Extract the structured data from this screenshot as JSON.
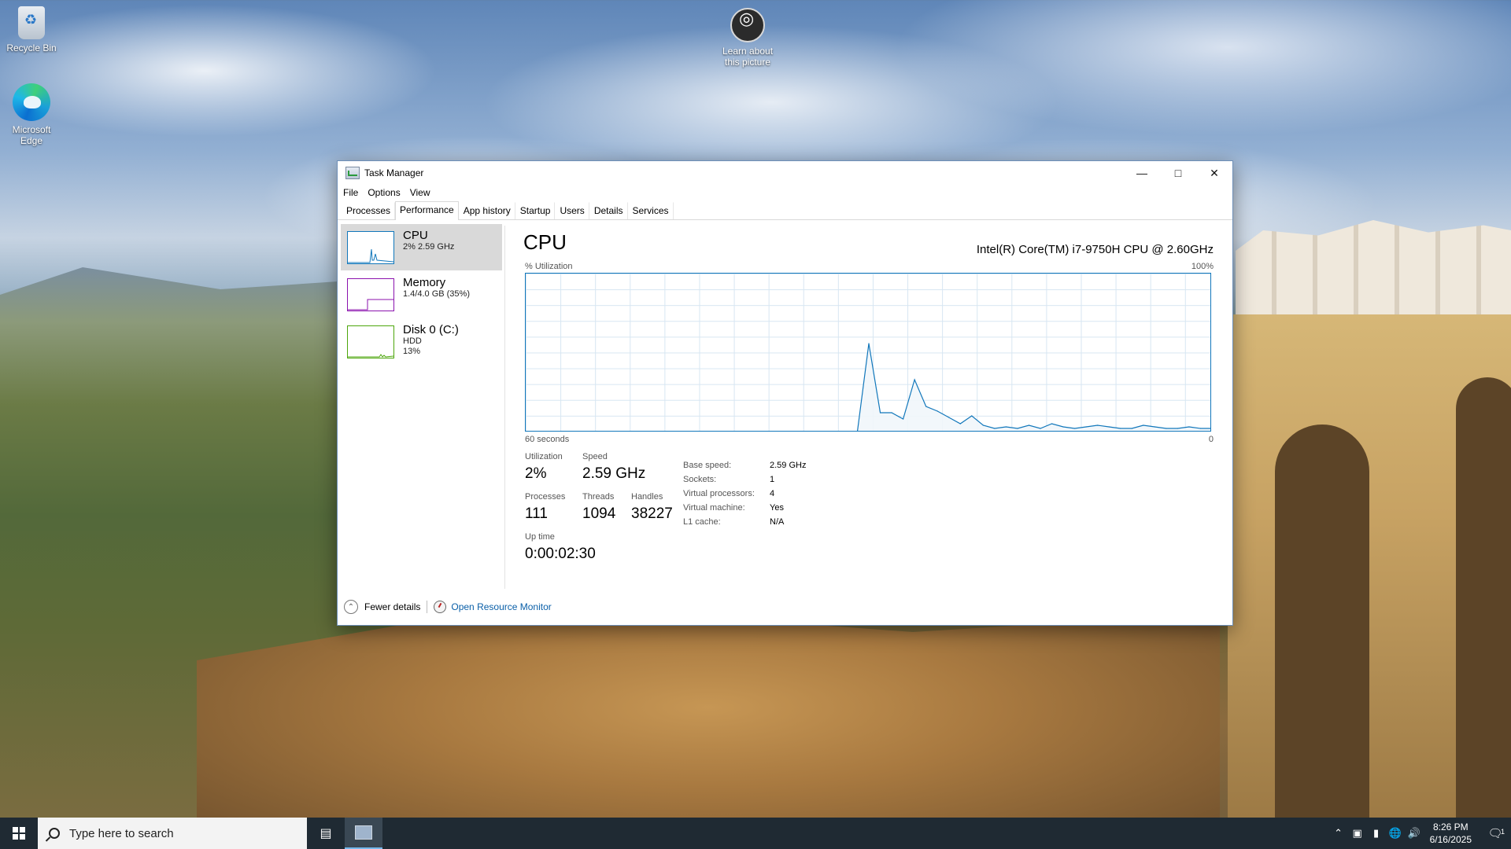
{
  "desktop": {
    "icons": [
      {
        "label": "Recycle Bin"
      },
      {
        "label": "Microsoft Edge"
      },
      {
        "label": "Learn about this picture"
      }
    ]
  },
  "window": {
    "title": "Task Manager",
    "menu": [
      "File",
      "Options",
      "View"
    ],
    "tabs": [
      "Processes",
      "Performance",
      "App history",
      "Startup",
      "Users",
      "Details",
      "Services"
    ],
    "active_tab": "Performance"
  },
  "sidebar": {
    "items": [
      {
        "name": "CPU",
        "line1": "2% 2.59 GHz",
        "line2": ""
      },
      {
        "name": "Memory",
        "line1": "1.4/4.0 GB (35%)",
        "line2": ""
      },
      {
        "name": "Disk 0 (C:)",
        "line1": "HDD",
        "line2": "13%"
      }
    ]
  },
  "cpu": {
    "title": "CPU",
    "model": "Intel(R) Core(TM) i7-9750H CPU @ 2.60GHz",
    "util_label": "% Utilization",
    "max_label": "100%",
    "time_label": "60 seconds",
    "min_label": "0",
    "stats": {
      "utilization_label": "Utilization",
      "utilization": "2%",
      "speed_label": "Speed",
      "speed": "2.59 GHz",
      "processes_label": "Processes",
      "processes": "111",
      "threads_label": "Threads",
      "threads": "1094",
      "handles_label": "Handles",
      "handles": "38227",
      "uptime_label": "Up time",
      "uptime": "0:00:02:30"
    },
    "properties": [
      {
        "key": "Base speed:",
        "value": "2.59 GHz"
      },
      {
        "key": "Sockets:",
        "value": "1"
      },
      {
        "key": "Virtual processors:",
        "value": "4"
      },
      {
        "key": "Virtual machine:",
        "value": "Yes"
      },
      {
        "key": "L1 cache:",
        "value": "N/A"
      }
    ]
  },
  "chart_data": {
    "type": "area",
    "x_label": "60 seconds",
    "y_label": "% Utilization",
    "ylim": [
      0,
      100
    ],
    "x": [
      60,
      59,
      58,
      57,
      56,
      55,
      54,
      53,
      52,
      51,
      50,
      49,
      48,
      47,
      46,
      45,
      44,
      43,
      42,
      41,
      40,
      39,
      38,
      37,
      36,
      35,
      34,
      33,
      32,
      31,
      30,
      29,
      28,
      27,
      26,
      25,
      24,
      23,
      22,
      21,
      20,
      19,
      18,
      17,
      16,
      15,
      14,
      13,
      12,
      11,
      10,
      9,
      8,
      7,
      6,
      5,
      4,
      3,
      2,
      1,
      0
    ],
    "series": [
      {
        "values": [
          0,
          0,
          0,
          0,
          0,
          0,
          0,
          0,
          0,
          0,
          0,
          0,
          0,
          0,
          0,
          0,
          0,
          0,
          0,
          0,
          0,
          0,
          0,
          0,
          0,
          0,
          0,
          0,
          0,
          0,
          56,
          12,
          12,
          8,
          33,
          16,
          13,
          9,
          5,
          10,
          4,
          2,
          3,
          2,
          4,
          2,
          5,
          3,
          2,
          3,
          4,
          3,
          2,
          2,
          4,
          3,
          2,
          2,
          3,
          2,
          2
        ]
      }
    ],
    "colors": {
      "line": "#1177bb",
      "fill": "#f1f6fb"
    }
  },
  "footer": {
    "fewer_details": "Fewer details",
    "open_rm": "Open Resource Monitor"
  },
  "taskbar": {
    "search_placeholder": "Type here to search",
    "time": "8:26 PM",
    "date": "6/16/2025",
    "notifications": "1"
  }
}
